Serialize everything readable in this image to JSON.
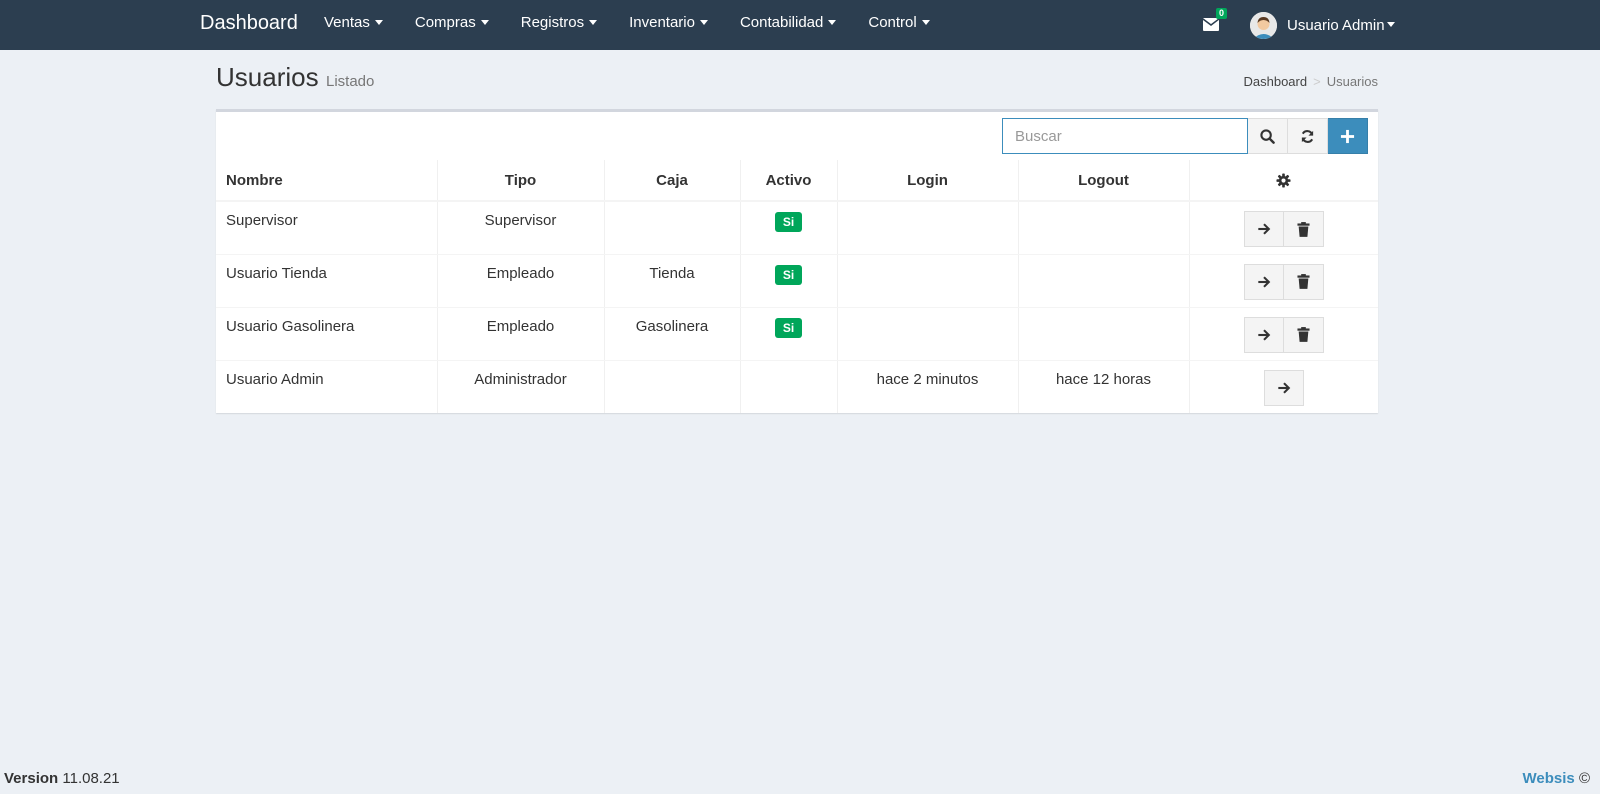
{
  "navbar": {
    "brand": "Dashboard",
    "menu": [
      {
        "label": "Ventas"
      },
      {
        "label": "Compras"
      },
      {
        "label": "Registros"
      },
      {
        "label": "Inventario"
      },
      {
        "label": "Contabilidad"
      },
      {
        "label": "Control"
      }
    ],
    "messages_count": "0",
    "user_name": "Usuario Admin"
  },
  "header": {
    "title": "Usuarios",
    "subtitle": "Listado",
    "breadcrumb": [
      "Dashboard",
      "Usuarios"
    ]
  },
  "search": {
    "placeholder": "Buscar",
    "value": ""
  },
  "table": {
    "columns": [
      "Nombre",
      "Tipo",
      "Caja",
      "Activo",
      "Login",
      "Logout"
    ],
    "rows": [
      {
        "nombre": "Supervisor",
        "tipo": "Supervisor",
        "caja": "",
        "activo": "Si",
        "login": "",
        "logout": ""
      },
      {
        "nombre": "Usuario Tienda",
        "tipo": "Empleado",
        "caja": "Tienda",
        "activo": "Si",
        "login": "",
        "logout": ""
      },
      {
        "nombre": "Usuario Gasolinera",
        "tipo": "Empleado",
        "caja": "Gasolinera",
        "activo": "Si",
        "login": "",
        "logout": ""
      },
      {
        "nombre": "Usuario Admin",
        "tipo": "Administrador",
        "caja": "",
        "activo": "",
        "login": "hace 2 minutos",
        "logout": "hace 12 horas"
      }
    ]
  },
  "footer": {
    "version_label": "Version",
    "version": "11.08.21",
    "brand": "Websis",
    "copyright": "©"
  },
  "colors": {
    "navbar": "#2c3e50",
    "primary": "#3c8dbc",
    "success": "#00a65a",
    "background": "#ecf0f5"
  }
}
